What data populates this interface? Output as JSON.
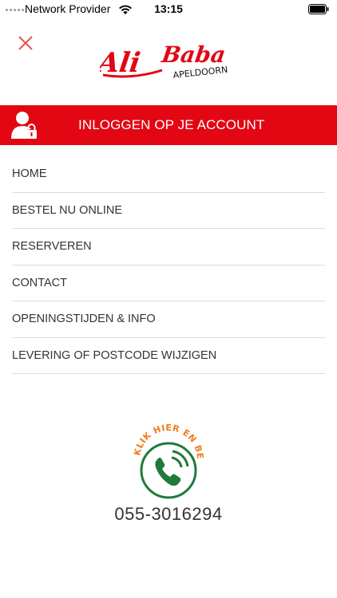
{
  "status_bar": {
    "carrier": "Network Provider",
    "time": "13:15"
  },
  "header": {
    "logo_name": "Ali Baba",
    "logo_subtitle": "APELDOORN"
  },
  "login": {
    "label": "INLOGGEN OP JE ACCOUNT"
  },
  "menu": {
    "items": [
      {
        "label": "HOME"
      },
      {
        "label": "BESTEL NU ONLINE"
      },
      {
        "label": "RESERVEREN"
      },
      {
        "label": "CONTACT"
      },
      {
        "label": "OPENINGSTIJDEN & INFO"
      },
      {
        "label": "LEVERING OF POSTCODE WIJZIGEN"
      }
    ]
  },
  "call": {
    "tagline": "KLIK HIER EN BEL",
    "phone": "055-3016294"
  },
  "colors": {
    "accent": "#e30613",
    "call_green": "#1f7a3c",
    "call_orange": "#f07d1a"
  }
}
